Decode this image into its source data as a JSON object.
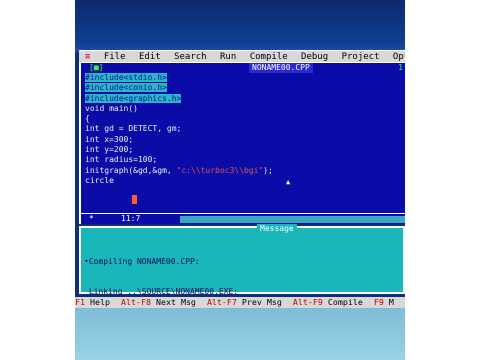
{
  "menu": {
    "system_icon": "≡",
    "items": [
      "File",
      "Edit",
      "Search",
      "Run",
      "Compile",
      "Debug",
      "Project",
      "Options"
    ]
  },
  "editor": {
    "close_box": "[■]",
    "filename": "NONAME00.CPP",
    "resize_box": "1",
    "code_lines": [
      {
        "text": "#include<stdio.h>",
        "highlight": true
      },
      {
        "text": "#include<conio.h>",
        "highlight": true
      },
      {
        "text": "#include<graphics.h>",
        "highlight": true
      },
      {
        "text": "void main()",
        "highlight": false
      },
      {
        "text": "{",
        "highlight": false
      },
      {
        "text": "int gd = DETECT, gm;",
        "highlight": false
      },
      {
        "text": "int x=300;",
        "highlight": false
      },
      {
        "text": "int y=200;",
        "highlight": false
      },
      {
        "text": "int radius=100;",
        "highlight": false
      },
      {
        "text": "initgraph(&gd,&gm, \"c:\\\\turboc3\\\\bgi\");",
        "highlight": false
      },
      {
        "text": "circle",
        "highlight": false
      }
    ],
    "modified_marker": "*",
    "cursor_position": "11:7"
  },
  "message_window": {
    "title": "Message",
    "lines": [
      "•Compiling NONAME00.CPP:",
      " Linking ..\\SOURCE\\NONAME00.EXE:"
    ]
  },
  "status_bar": [
    {
      "key": "F1",
      "label": "Help"
    },
    {
      "key": "Alt-F8",
      "label": "Next Msg"
    },
    {
      "key": "Alt-F7",
      "label": "Prev Msg"
    },
    {
      "key": "Alt-F9",
      "label": "Compile"
    },
    {
      "key": "F9",
      "label": "M"
    }
  ],
  "colors": {
    "editor_bg": "#0b0ba8",
    "menu_bg": "#d8d8d8",
    "message_bg": "#19b7b9",
    "highlight": "#2ab7c4"
  }
}
